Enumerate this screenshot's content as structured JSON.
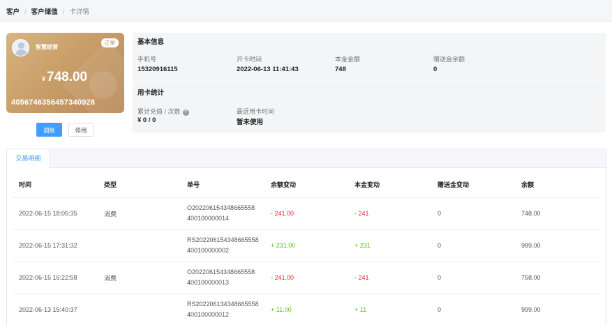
{
  "breadcrumb": {
    "items": [
      "客户",
      "客户储值"
    ],
    "current": "卡详情",
    "separator": "/"
  },
  "card": {
    "name": "智慧经营",
    "status": "正常",
    "currency": "¥",
    "amount": "748.00",
    "number": "4056746356457340928",
    "avatar_icon": "user-avatar-icon"
  },
  "actions": {
    "adjust_label": "调账",
    "disable_label": "停用"
  },
  "basic_info": {
    "title": "基本信息",
    "phone_label": "手机号",
    "phone_value": "15320916115",
    "open_time_label": "开卡时间",
    "open_time_value": "2022-06-13 11:41:43",
    "principal_label": "本金金额",
    "principal_value": "748",
    "gift_label": "赠送金余额",
    "gift_value": "0"
  },
  "usage_stats": {
    "title": "用卡统计",
    "recharge_label": "累计充值 / 次数",
    "recharge_value": "¥ 0 / 0",
    "last_use_label": "最近用卡时间",
    "last_use_value": "暂未使用",
    "help_icon": "?"
  },
  "transactions": {
    "tab_label": "交易明细",
    "columns": [
      "时间",
      "类型",
      "单号",
      "余额变动",
      "本金变动",
      "赠送金变动",
      "余额"
    ],
    "rows": [
      {
        "time": "2022-06-15 18:05:35",
        "type": "消费",
        "order_line1": "O202206154348665558",
        "order_line2": "400100000014",
        "balance_change": "- 241.00",
        "principal_change": "- 241",
        "gift_change": "0",
        "balance": "748.00"
      },
      {
        "time": "2022-06-15 17:31:32",
        "type": "",
        "order_line1": "RS202206154348665558",
        "order_line2": "400100000002",
        "balance_change": "+ 231.00",
        "principal_change": "+ 231",
        "gift_change": "0",
        "balance": "989.00"
      },
      {
        "time": "2022-06-15 16:22:58",
        "type": "消费",
        "order_line1": "O202206154348665558",
        "order_line2": "400100000013",
        "balance_change": "- 241.00",
        "principal_change": "- 241",
        "gift_change": "0",
        "balance": "758.00"
      },
      {
        "time": "2022-06-13 15:40:37",
        "type": "",
        "order_line1": "RS202206134348665558",
        "order_line2": "400100000012",
        "balance_change": "+ 11.00",
        "principal_change": "+ 11",
        "gift_change": "0",
        "balance": "999.00"
      }
    ]
  },
  "colors": {
    "primary": "#409eff",
    "negative": "#f5222d",
    "positive": "#52c41a",
    "card_gold": "#c99e68"
  }
}
